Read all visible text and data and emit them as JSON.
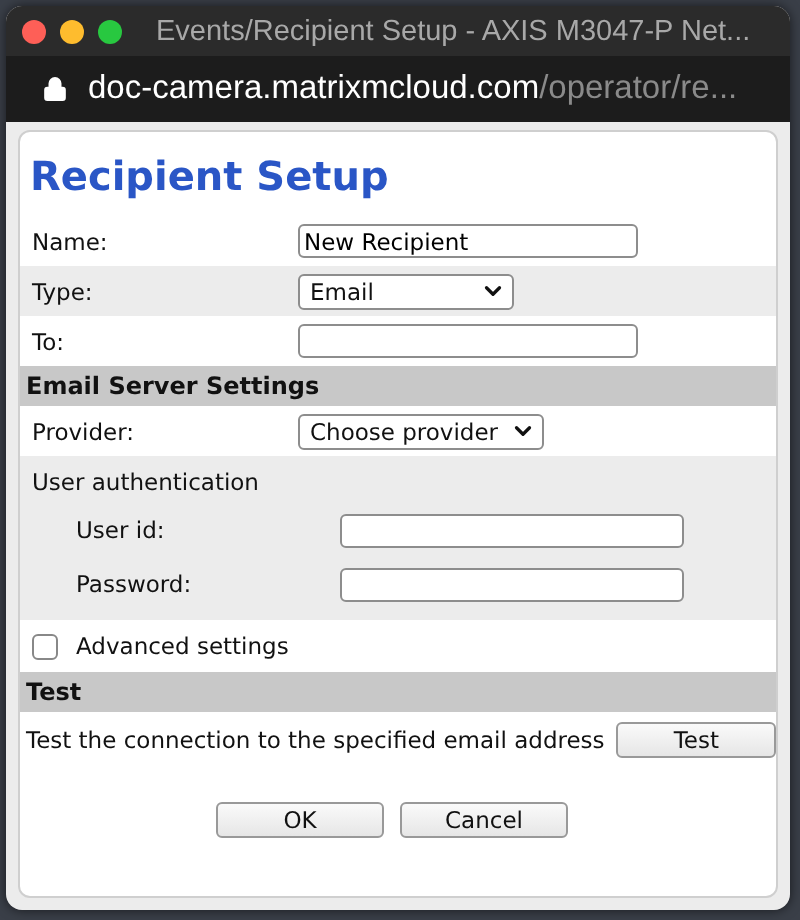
{
  "window": {
    "title": "Events/Recipient Setup - AXIS M3047-P Net...",
    "url_host": "doc-camera.matrixmcloud.com",
    "url_path": "/operator/re..."
  },
  "heading": "Recipient Setup",
  "fields": [
    {
      "kind": "text",
      "label": "Name:",
      "value": "New Recipient",
      "shaded": false
    },
    {
      "kind": "select",
      "label": "Type:",
      "value": "Email",
      "shaded": true
    },
    {
      "kind": "text",
      "label": "To:",
      "shaded": false
    }
  ],
  "email_server": {
    "title": "Email Server Settings",
    "provider": {
      "label": "Provider:",
      "value": "Choose provider"
    },
    "auth": {
      "title": "User authentication",
      "fields": [
        {
          "label": "User id:"
        },
        {
          "label": "Password:"
        }
      ]
    },
    "advanced": {
      "label": "Advanced settings",
      "checked": false
    }
  },
  "test": {
    "title": "Test",
    "description": "Test the connection to the specified email address",
    "button": "Test"
  },
  "buttons": [
    "OK",
    "Cancel"
  ]
}
